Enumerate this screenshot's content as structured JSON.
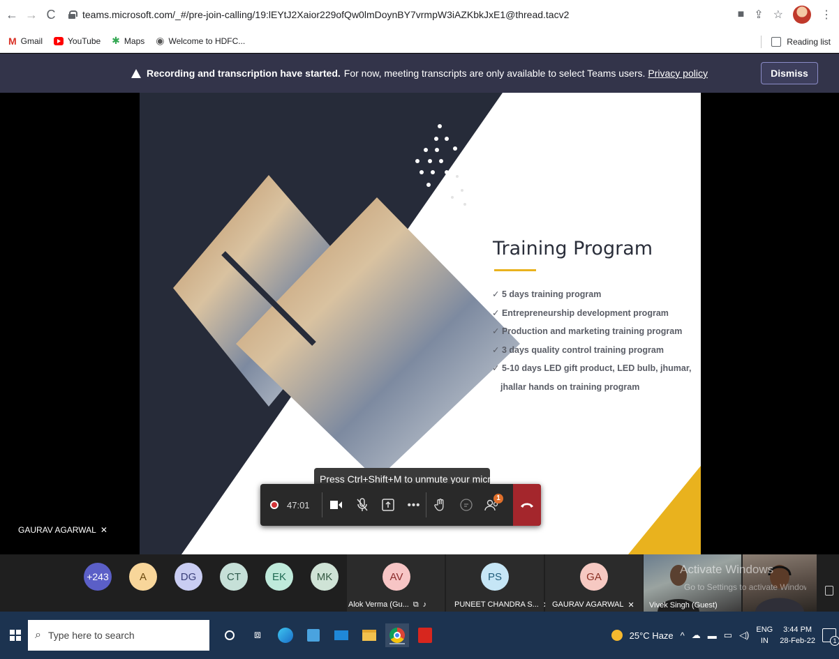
{
  "browser": {
    "url": "teams.microsoft.com/_#/pre-join-calling/19:lEYtJ2Xaior229ofQw0lmDoynBY7vrmpW3iAZKbkJxE1@thread.tacv2",
    "bookmarks": [
      "Gmail",
      "YouTube",
      "Maps",
      "Welcome to HDFC..."
    ],
    "reading_list": "Reading list"
  },
  "banner": {
    "bold": "Recording and transcription have started.",
    "text": "For now, meeting transcripts are only available to select Teams users.",
    "link": "Privacy policy",
    "dismiss": "Dismiss"
  },
  "slide": {
    "title": "Training Program",
    "bullets": [
      "5 days training program",
      "Entrepreneurship development program",
      "Production and marketing training program",
      "3 days quality control training program",
      "5-10 days LED gift product, LED bulb, jhumar,"
    ],
    "bullet_continuation": "jhallar hands on training program"
  },
  "call": {
    "tooltip": "Press Ctrl+Shift+M to unmute your microphone.",
    "timer": "47:01",
    "people_badge": "1",
    "main_speaker": "GAURAV AGARWAL"
  },
  "participants": {
    "overflow": "+243",
    "avatars": [
      {
        "initials": "A",
        "bg": "#f8d69a",
        "fg": "#6b4a10"
      },
      {
        "initials": "DG",
        "bg": "#c9cdf2",
        "fg": "#3a3f7a"
      },
      {
        "initials": "CT",
        "bg": "#c6e0d8",
        "fg": "#2f5a4c"
      },
      {
        "initials": "EK",
        "bg": "#bfeadb",
        "fg": "#1e6a52"
      },
      {
        "initials": "MK",
        "bg": "#cfe3d6",
        "fg": "#355a42"
      }
    ],
    "tiles": [
      {
        "initials": "AV",
        "name": "Alok Verma (Gu...",
        "bg": "#f7c5c5",
        "fg": "#8a2a2a"
      },
      {
        "initials": "PS",
        "name": "PUNEET CHANDRA S...",
        "bg": "#c6e6f6",
        "fg": "#1f5c7a"
      },
      {
        "initials": "GA",
        "name": "GAURAV AGARWAL",
        "bg": "#f6c9c2",
        "fg": "#8a2f22"
      }
    ],
    "video_name": "Vivek Singh (Guest)",
    "watermark_line1": "Activate Windows",
    "watermark_line2": "Go to Settings to activate Windows."
  },
  "taskbar": {
    "search_placeholder": "Type here to search",
    "weather": "25°C Haze",
    "lang_top": "ENG",
    "lang_bottom": "IN",
    "time": "3:44 PM",
    "date": "28-Feb-22",
    "notif_count": "1"
  }
}
